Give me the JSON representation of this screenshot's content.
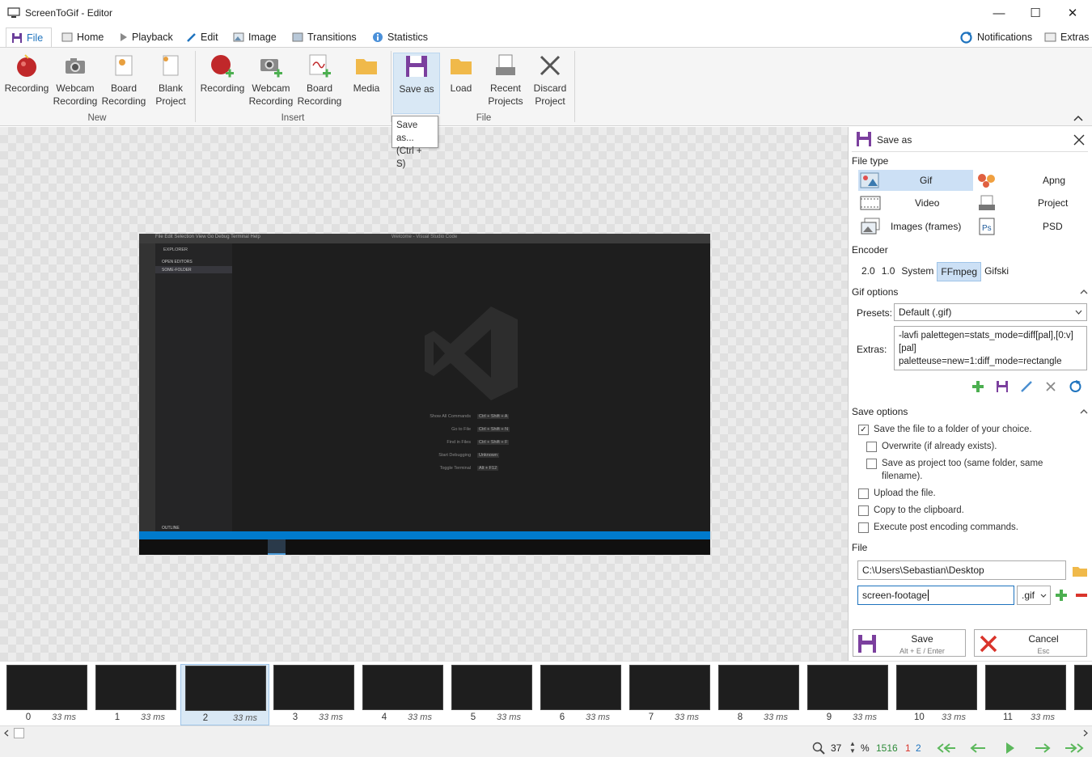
{
  "window": {
    "title": "ScreenToGif - Editor",
    "minimize": "—",
    "maximize": "☐",
    "close": "✕"
  },
  "tabs": [
    {
      "label": "File"
    },
    {
      "label": "Home"
    },
    {
      "label": "Playback"
    },
    {
      "label": "Edit"
    },
    {
      "label": "Image"
    },
    {
      "label": "Transitions"
    },
    {
      "label": "Statistics"
    }
  ],
  "tabs_right": {
    "notifications": "Notifications",
    "extras": "Extras"
  },
  "ribbon": {
    "new": {
      "group": "New",
      "recording": "Recording",
      "webcam1": "Webcam",
      "webcam2": "Recording",
      "board1": "Board",
      "board2": "Recording",
      "blank1": "Blank",
      "blank2": "Project"
    },
    "insert": {
      "group": "Insert",
      "recording": "Recording",
      "webcam1": "Webcam",
      "webcam2": "Recording",
      "board1": "Board",
      "board2": "Recording",
      "media": "Media"
    },
    "file": {
      "group": "File",
      "saveas": "Save as",
      "load": "Load",
      "recent1": "Recent",
      "recent2": "Projects",
      "discard1": "Discard",
      "discard2": "Project"
    }
  },
  "tooltip": {
    "line1": "Save as...",
    "line2": "(Ctrl + S)"
  },
  "vscode": {
    "menu": "File  Edit  Selection  View  Go  Debug  Terminal  Help",
    "title": "Welcome - Visual Studio Code",
    "explorer": "EXPLORER",
    "open_editors": "OPEN EDITORS",
    "folder": "SOME-FOLDER",
    "outline": "OUTLINE",
    "shortcuts": [
      {
        "label": "Show All Commands",
        "keys": "Ctrl + Shift + A"
      },
      {
        "label": "Go to File",
        "keys": "Ctrl + Shift + N"
      },
      {
        "label": "Find in Files",
        "keys": "Ctrl + Shift + F"
      },
      {
        "label": "Start Debugging",
        "keys": "Unknown"
      },
      {
        "label": "Toggle Terminal",
        "keys": "Alt + F12"
      }
    ]
  },
  "panel": {
    "title": "Save as",
    "file_type_label": "File type",
    "types": [
      "Gif",
      "Apng",
      "Video",
      "Project",
      "Images (frames)",
      "PSD"
    ],
    "encoder_label": "Encoder",
    "encoders": [
      "2.0",
      "1.0",
      "System",
      "FFmpeg",
      "Gifski"
    ],
    "encoder_selected": "FFmpeg",
    "gif_options_label": "Gif options",
    "presets_label": "Presets:",
    "preset_value": "Default (.gif)",
    "extras_label": "Extras:",
    "extras_line1": "-lavfi palettegen=stats_mode=diff[pal],[0:v]",
    "extras_line2": "[pal]",
    "extras_line3": "paletteuse=new=1:diff_mode=rectangle",
    "save_options_label": "Save options",
    "opt_folder": "Save the file to a folder of your choice.",
    "opt_overwrite": "Overwrite (if already exists).",
    "opt_project1": "Save as project too (same folder, same",
    "opt_project2": "filename).",
    "opt_upload": "Upload the file.",
    "opt_clipboard": "Copy to the clipboard.",
    "opt_post": "Execute post encoding commands.",
    "file_label": "File",
    "folder_value": "C:\\Users\\Sebastian\\Desktop",
    "filename_value": "screen-footage",
    "extension": ".gif",
    "save_label": "Save",
    "save_shortcut": "Alt + E / Enter",
    "cancel_label": "Cancel",
    "cancel_shortcut": "Esc"
  },
  "frames": [
    {
      "n": "0",
      "ms": "33 ms"
    },
    {
      "n": "1",
      "ms": "33 ms"
    },
    {
      "n": "2",
      "ms": "33 ms"
    },
    {
      "n": "3",
      "ms": "33 ms"
    },
    {
      "n": "4",
      "ms": "33 ms"
    },
    {
      "n": "5",
      "ms": "33 ms"
    },
    {
      "n": "6",
      "ms": "33 ms"
    },
    {
      "n": "7",
      "ms": "33 ms"
    },
    {
      "n": "8",
      "ms": "33 ms"
    },
    {
      "n": "9",
      "ms": "33 ms"
    },
    {
      "n": "10",
      "ms": "33 ms"
    },
    {
      "n": "11",
      "ms": "33 ms"
    }
  ],
  "status": {
    "zoom": "37",
    "percent": "%",
    "total": "1516",
    "selected": "1",
    "current": "2"
  },
  "colors": {
    "accent": "#1e73be",
    "green": "#4caf50",
    "red": "#d9342b",
    "purple": "#7b3f9e"
  }
}
